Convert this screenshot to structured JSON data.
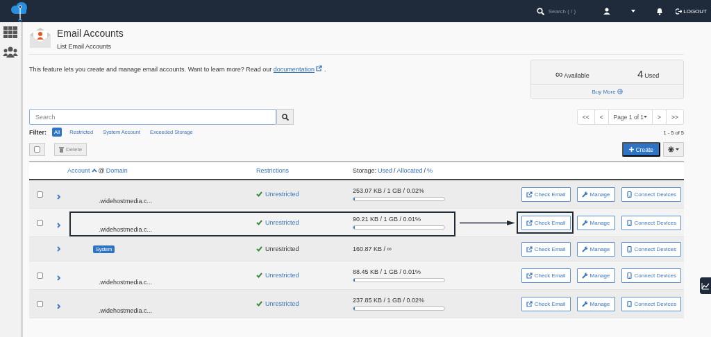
{
  "topbar": {
    "search_placeholder": "Search ( / )",
    "logout": "LOGOUT"
  },
  "page": {
    "title": "Email Accounts",
    "subtitle": "List Email Accounts",
    "description": "This feature lets you create and manage email accounts. Want to learn more? Read our ",
    "doc_link": "documentation",
    "description_end": "."
  },
  "stats": {
    "available": "∞",
    "available_label": "Available",
    "used": "4",
    "used_label": "Used",
    "buy_more": "Buy More"
  },
  "search": {
    "placeholder": "Search"
  },
  "filter": {
    "label": "Filter:",
    "options": [
      {
        "label": "All",
        "selected": true
      },
      {
        "label": "Restricted",
        "selected": false
      },
      {
        "label": "System Account",
        "selected": false
      },
      {
        "label": "Exceeded Storage",
        "selected": false
      }
    ]
  },
  "pagination": {
    "first": "<<",
    "prev": "<",
    "page": "Page 1 of 1",
    "next": ">",
    "last": ">>",
    "range": "1 - 5 of 5"
  },
  "toolbar": {
    "select_all_checked": false,
    "delete": "Delete",
    "create": "Create"
  },
  "table": {
    "columns": {
      "account": "Account",
      "at": "@",
      "domain": "Domain",
      "restrictions": "Restrictions",
      "storage": "Storage:",
      "used": "Used",
      "separator": "/",
      "allocated": "Allocated",
      "separator_2": "/",
      "percent": "%"
    },
    "rows": [
      {
        "kind": "account",
        "checked": false,
        "domain": ".widehostmedia.c...",
        "restriction": "Unrestricted",
        "storage": "253.07 KB / 1 GB / 0.02%",
        "level": 0.0002,
        "highlighted": false,
        "actions": [
          "Check Email",
          "Manage",
          "Connect Devices"
        ]
      },
      {
        "kind": "account",
        "checked": false,
        "domain": ".widehostmedia.c...",
        "restriction": "Unrestricted",
        "storage": "90.21 KB / 1 GB / 0.01%",
        "level": 0.0001,
        "highlighted": true,
        "actions": [
          "Check Email",
          "Manage",
          "Connect Devices"
        ]
      },
      {
        "kind": "system",
        "badge": "System",
        "restriction": "Unrestricted",
        "storage": "160.87 KB / ∞",
        "highlighted": false,
        "actions": [
          "Check Email",
          "Manage",
          "Connect Devices"
        ]
      },
      {
        "kind": "account",
        "checked": false,
        "domain": ".widehostmedia.c...",
        "restriction": "Unrestricted",
        "storage": "88.45 KB / 1 GB / 0.01%",
        "level": 0.0001,
        "highlighted": false,
        "actions": [
          "Check Email",
          "Manage",
          "Connect Devices"
        ]
      },
      {
        "kind": "account",
        "checked": false,
        "domain": ".widehostmedia.c...",
        "restriction": "Unrestricted",
        "storage": "237.85 KB / 1 GB / 0.02%",
        "level": 0.0002,
        "highlighted": false,
        "actions": [
          "Check Email",
          "Manage",
          "Connect Devices"
        ]
      }
    ]
  }
}
